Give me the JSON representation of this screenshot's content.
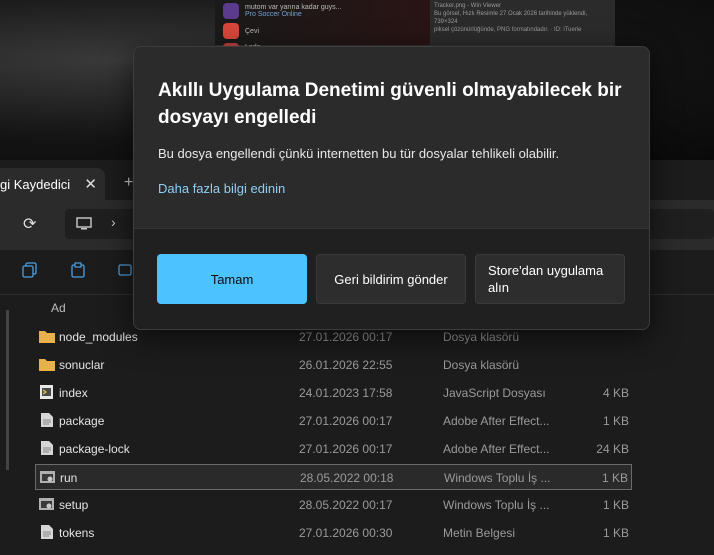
{
  "background_window": {
    "chat": [
      {
        "name": "mutom var yarına kadar guys...",
        "sub": "Pro Soccer Online",
        "avatar_color": "#5b3b8c"
      },
      {
        "name": "Çevi",
        "sub": "",
        "avatar_color": "#d9473a"
      },
      {
        "name": "Lada",
        "sub": "",
        "avatar_color": "#c04040"
      }
    ],
    "panel_lines": [
      "Tracker.png - Win Viewer",
      "Bu görsel, Hızlı Resimle 27 Ocak 2026 tarihinde yüklendi, 739×324",
      "piksel çözünürlüğünde, PNG formatındadır. · ID: iTuerie"
    ]
  },
  "explorer": {
    "tab_label": "gi Kaydedici",
    "tab_close": "✕",
    "tab_add": "+",
    "columns": {
      "name": "Ad"
    },
    "files": [
      {
        "name": "node_modules",
        "date": "27.01.2026 00:17",
        "type": "Dosya klasörü",
        "size": "",
        "icon": "folder-icon"
      },
      {
        "name": "sonuclar",
        "date": "26.01.2026 22:55",
        "type": "Dosya klasörü",
        "size": "",
        "icon": "folder-icon"
      },
      {
        "name": "index",
        "date": "24.01.2023 17:58",
        "type": "JavaScript Dosyası",
        "size": "4 KB",
        "icon": "script-file-icon"
      },
      {
        "name": "package",
        "date": "27.01.2026 00:17",
        "type": "Adobe After Effect...",
        "size": "1 KB",
        "icon": "document-icon"
      },
      {
        "name": "package-lock",
        "date": "27.01.2026 00:17",
        "type": "Adobe After Effect...",
        "size": "24 KB",
        "icon": "document-icon"
      },
      {
        "name": "run",
        "date": "28.05.2022 00:18",
        "type": "Windows Toplu İş ...",
        "size": "1 KB",
        "icon": "batch-file-icon",
        "selected": true
      },
      {
        "name": "setup",
        "date": "28.05.2022 00:17",
        "type": "Windows Toplu İş ...",
        "size": "1 KB",
        "icon": "batch-file-icon"
      },
      {
        "name": "tokens",
        "date": "27.01.2026 00:30",
        "type": "Metin Belgesi",
        "size": "1 KB",
        "icon": "document-icon"
      }
    ]
  },
  "dialog": {
    "title": "Akıllı Uygulama Denetimi güvenli olmayabilecek bir dosyayı engelledi",
    "body": "Bu dosya engellendi çünkü internetten bu tür dosyalar tehlikeli olabilir.",
    "link": "Daha fazla bilgi edinin",
    "buttons": {
      "ok": "Tamam",
      "feedback": "Geri bildirim gönder",
      "store": "Store'dan uygulama alın"
    },
    "accent_color": "#4cc2ff",
    "link_color": "#8ed0f5"
  }
}
